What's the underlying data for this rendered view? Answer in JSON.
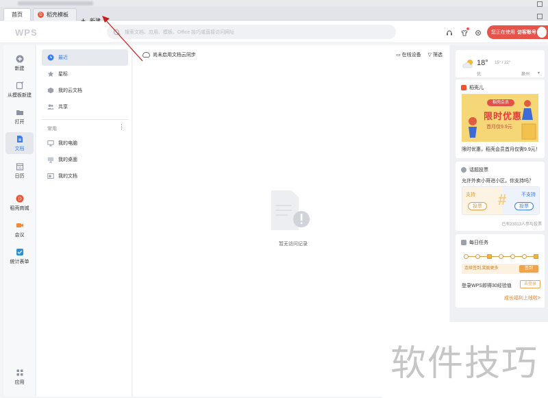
{
  "tabs": {
    "home": "首页",
    "template": "稻壳模板",
    "new": "新建"
  },
  "header": {
    "logo": "WPS",
    "search_placeholder": "搜索文档、应用、模板、Office 技巧或直接访问网址",
    "user_status": "您正在使用",
    "user_name": "访客账号"
  },
  "rail": {
    "items": [
      {
        "label": "新建",
        "icon": "plus-circle-icon"
      },
      {
        "label": "从模板新建",
        "icon": "template-icon"
      },
      {
        "label": "打开",
        "icon": "folder-icon"
      },
      {
        "label": "文档",
        "icon": "document-icon"
      },
      {
        "label": "日历",
        "icon": "calendar-icon"
      },
      {
        "label": "稻壳商城",
        "icon": "docer-mall-icon"
      },
      {
        "label": "会议",
        "icon": "meeting-icon"
      },
      {
        "label": "统计表单",
        "icon": "form-icon"
      }
    ],
    "apps": "应用"
  },
  "nav": {
    "items": [
      {
        "label": "最近",
        "icon": "clock-icon"
      },
      {
        "label": "星标",
        "icon": "star-icon"
      },
      {
        "label": "我的云文档",
        "icon": "cloud-doc-icon"
      },
      {
        "label": "共享",
        "icon": "share-icon"
      }
    ],
    "section_label": "常用",
    "common": [
      {
        "label": "我的电脑",
        "icon": "computer-icon"
      },
      {
        "label": "我的桌面",
        "icon": "desktop-icon"
      },
      {
        "label": "我的文档",
        "icon": "my-docs-icon"
      }
    ]
  },
  "main": {
    "sync_notice": "尚未启用文档云同步",
    "online_devices": "在线设备",
    "filter": "筛选",
    "empty_text": "暂无访问记录"
  },
  "weather": {
    "temp": "18°",
    "range": "15° / 22°",
    "condition": "优",
    "city": "泉州"
  },
  "docer": {
    "title": "稻壳儿",
    "badge": "稻壳会员",
    "headline": "限时优惠",
    "sub": "首月仅9.9元",
    "caption": "限时优惠，稻壳会员首月仅需9.9元！"
  },
  "poll": {
    "title": "话题投票",
    "question": "允许外卖小哥进小区，你支持吗？",
    "support": "支持",
    "oppose": "不支持",
    "vote": "投票",
    "count": "已有23313人参与投票"
  },
  "task": {
    "title": "每日任务",
    "streak": "连续签到,奖励更多",
    "sign": "签到",
    "login_text": "登录WPS即得30经验值",
    "login_btn": "去登录",
    "more": "成长福利上线啦>"
  },
  "watermark": "软件技巧"
}
